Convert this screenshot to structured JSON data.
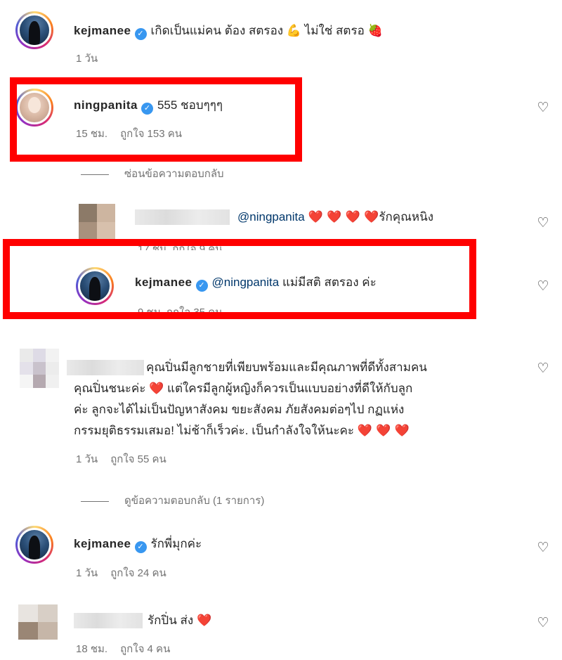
{
  "comments": [
    {
      "username": "kejmanee",
      "text": "เกิดเป็นแม่คน ต้อง สตรอง",
      "emoji_arm": "💪",
      "text2": "ไม่ใช่ สตรอ",
      "emoji_strawberry": "🍓",
      "time": "1 วัน"
    },
    {
      "username": "ningpanita",
      "text": "555 ชอบๆๆๆ",
      "time": "15 ชม.",
      "likes": "ถูกใจ 153 คน",
      "replies_toggle": "ซ่อนข้อความตอบกลับ",
      "replies": [
        {
          "mention": "@ningpanita",
          "hearts": "❤️ ❤️ ❤️ ❤️",
          "text": "รักคุณหนิง",
          "meta": "17 ชม.   ถูกใจ 9 คน"
        },
        {
          "username": "kejmanee",
          "mention": "@ningpanita",
          "text": "แม่มีสติ สตรอง ค่ะ",
          "meta": "9 ชม.   ถูกใจ 35 คน"
        }
      ]
    },
    {
      "lines": [
        "คุณปิ่นมีลูกชายที่เพียบพร้อมและมีคุณภาพที่ดีทั้งสามคน",
        "คุณปิ่นชนะค่ะ",
        "แต่ใครมีลูกผู้หญิงก็ควรเป็นแบบอย่างที่ดีให้กับลูก",
        "ค่ะ ลูกจะได้ไม่เป็นปัญหาสังคม ขยะสังคม ภัยสังคมต่อๆไป กฏแห่ง",
        "กรรมยุติธรรมเสมอ! ไม่ช้าก็เร็วค่ะ. เป็นกำลังใจให้นะคะ"
      ],
      "heart": "❤️",
      "hearts_end": "❤️ ❤️ ❤️",
      "time": "1 วัน",
      "likes": "ถูกใจ 55 คน",
      "replies_toggle": "ดูข้อความตอบกลับ (1 รายการ)"
    },
    {
      "username": "kejmanee",
      "text": "รักพี่มุกค่ะ",
      "time": "1 วัน",
      "likes": "ถูกใจ 24 คน"
    },
    {
      "text": "รักปิ่น ส่ง",
      "heart": "❤️",
      "time": "18 ชม.",
      "likes": "ถูกใจ 4 คน"
    }
  ],
  "icons": {
    "like": "heart-outline-icon",
    "verified": "verified-badge-icon"
  },
  "colors": {
    "highlight_box": "#ff0000",
    "verified": "#3897f0",
    "mention": "#00376b",
    "heart": "#e0142c"
  }
}
